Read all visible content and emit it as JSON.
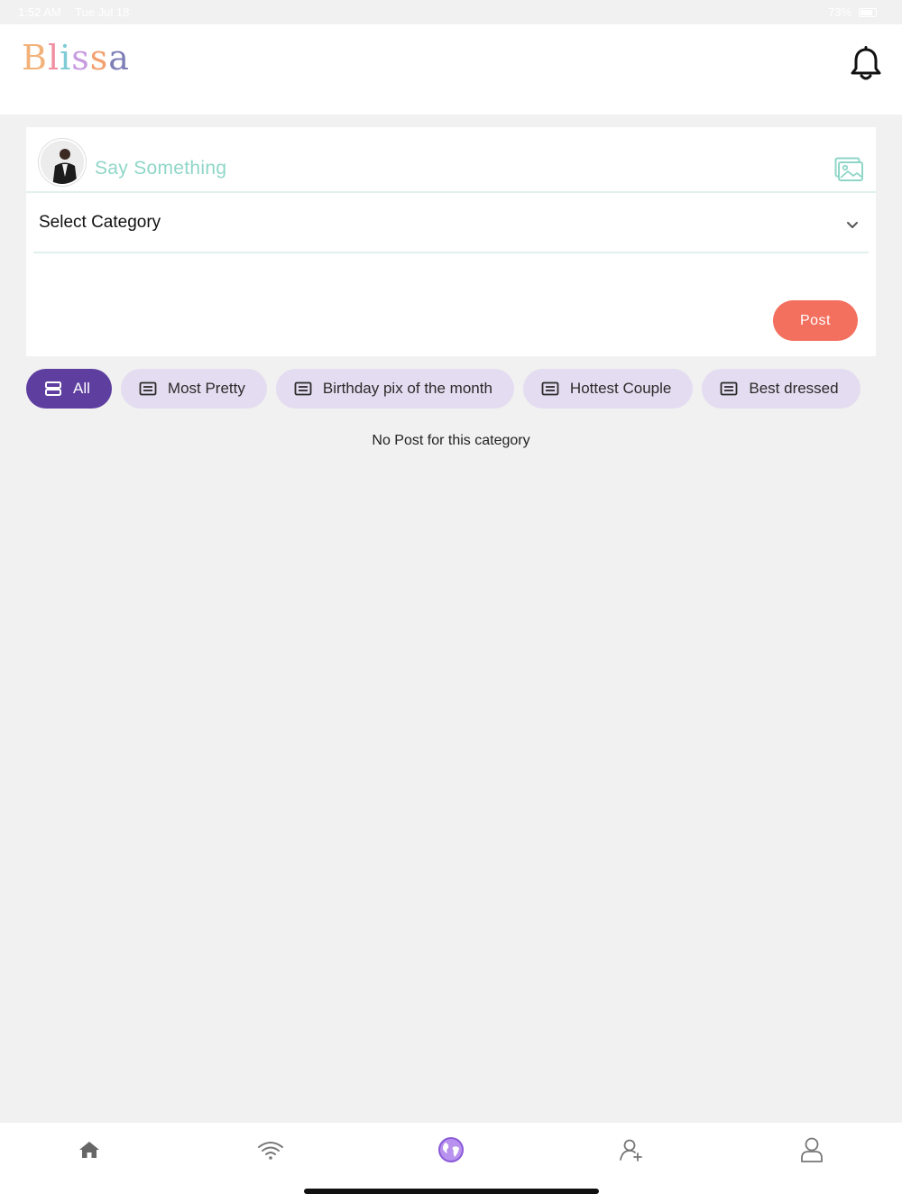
{
  "status_bar": {
    "time": "1:52 AM",
    "date": "Tue Jul 18",
    "battery": "73%"
  },
  "header": {
    "logo_letters": [
      "B",
      "l",
      "i",
      "s",
      "s",
      "a"
    ],
    "bell_icon": "bell-icon"
  },
  "composer": {
    "placeholder": "Say Something",
    "category_label": "Select Category",
    "post_label": "Post",
    "image_icon": "image-icon",
    "accent_color": "#8fd6c8",
    "post_color": "#f3705e"
  },
  "categories": [
    {
      "label": "All",
      "active": true,
      "icon": "stack-icon"
    },
    {
      "label": "Most Pretty",
      "active": false,
      "icon": "list-card-icon"
    },
    {
      "label": "Birthday pix of the month",
      "active": false,
      "icon": "list-card-icon"
    },
    {
      "label": "Hottest Couple",
      "active": false,
      "icon": "list-card-icon"
    },
    {
      "label": "Best dressed",
      "active": false,
      "icon": "list-card-icon"
    }
  ],
  "category_colors": {
    "active": "#5e3fa0",
    "inactive": "#e4dcf0"
  },
  "empty_message": "No Post for this category",
  "tab_bar": {
    "tabs": [
      {
        "name": "home",
        "icon": "home-icon",
        "active": false
      },
      {
        "name": "feed",
        "icon": "wifi-icon",
        "active": false
      },
      {
        "name": "explore",
        "icon": "globe-icon",
        "active": true
      },
      {
        "name": "add-friend",
        "icon": "add-user-icon",
        "active": false
      },
      {
        "name": "profile",
        "icon": "user-icon",
        "active": false
      }
    ],
    "active_color": "#9b6fe0"
  }
}
